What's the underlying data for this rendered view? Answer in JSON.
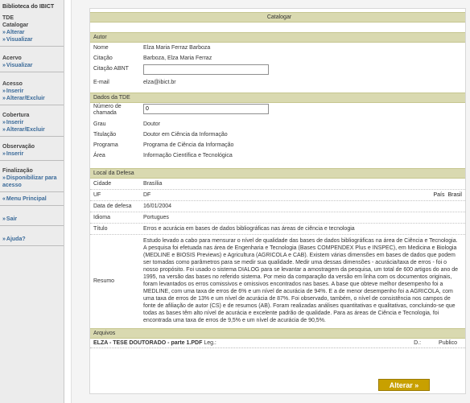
{
  "sidebar": {
    "title": "Biblioteca do IBICT",
    "tde_label": "TDE",
    "groups": [
      {
        "head": "Catalogar",
        "links": [
          "Alterar",
          "Visualizar"
        ]
      },
      {
        "head": "Acervo",
        "links": [
          "Visualizar"
        ]
      },
      {
        "head": "Acesso",
        "links": [
          "Inserir",
          "Alterar/Excluir"
        ]
      },
      {
        "head": "Cobertura",
        "links": [
          "Inserir",
          "Alterar/Excluir"
        ]
      },
      {
        "head": "Observação",
        "links": [
          "Inserir"
        ]
      },
      {
        "head": "Finalização",
        "links": [
          "Disponibilizar para acesso"
        ]
      }
    ],
    "menu_principal": "Menu Principal",
    "sair": "Sair",
    "ajuda": "Ajuda?"
  },
  "page": {
    "title": "Catalogar",
    "autor_section": "Autor",
    "nome_label": "Nome",
    "nome_value": "Elza Maria Ferraz Barboza",
    "citacao_label": "Citação",
    "citacao_value": "Barboza, Elza Maria Ferraz",
    "citacao_abnt_label": "Citação ABNT",
    "citacao_abnt_value": "",
    "email_label": "E-mail",
    "email_value": "elza@ibict.br",
    "tde_section": "Dados da TDE",
    "num_chamada_label": "Número de chamada",
    "num_chamada_value": "0",
    "grau_label": "Grau",
    "grau_value": "Doutor",
    "titulacao_label": "Titulação",
    "titulacao_value": "Doutor em Ciência da Informação",
    "programa_label": "Programa",
    "programa_value": "Programa de Ciência da Informação",
    "area_label": "Área",
    "area_value": "Informação Científica e Tecnológica",
    "local_section": "Local da Defesa",
    "cidade_label": "Cidade",
    "cidade_value": "Brasília",
    "uf_label": "UF",
    "uf_value": "DF",
    "pais_label": "País",
    "pais_value": "Brasil",
    "data_label": "Data de defesa",
    "data_value": "16/01/2004",
    "idioma_label": "Idioma",
    "idioma_value": "Portugues",
    "titulo_label": "Título",
    "titulo_value": "Erros e acurácia em bases de dados bibliográficas nas áreas de ciência e tecnologia",
    "resumo_label": "Resumo",
    "resumo_value": "Estudo levado a cabo para mensurar o nível de qualidade das bases de dados bibliográficas na área de Ciência e Tecnologia. A pesquisa foi efetuada nas área de Engenharia e Tecnologia (Bases COMPENDEX Plus e INSPEC), em Medicina e Biologia (MEDLINE e BIOSIS Previews) e Agricultura (AGRICOLA e CAB). Existem várias dimensões em bases de dados que podem ser tomadas como parâmetros para se medir sua qualidade. Medir uma dessas dimensões - acurácia/taxa de erros - foi o nosso propósito. Foi usado o sistema DIALOG para se levantar a amostragem da pesquisa, um total de 600 artigos do ano de 1995, na versão das bases no referido sistema. Por meio da comparação da versão em linha com os documentos originais, foram levantados os erros comissivos e omissivos encontrados nas bases. A base que obteve melhor desempenho foi a MEDLINE, com uma taxa de erros de 6% e um nível de acurácia de 94%. E a de menor desempenho foi a AGRICOLA, com uma taxa de erros de 13% e um nível de acurácia de 87%. Foi observado, também, o nível de consistência nos campos de fonte de afiliação de autor (CS) e de resumos (AB). Foram realizadas análises quantitativas e qualitativas, concluindo-se que todas as bases têm alto nível de acurácia e excelente padrão de qualidade. Para as áreas de Ciência e Tecnologia, foi encontrada uma taxa de erros de 9,5% e um nível de acurácia de 90,5%.",
    "arquivos_section": "Arquivos",
    "file_name": "ELZA - TESE DOUTORADO - parte 1.PDF",
    "file_leg": "Leg.:",
    "file_d": "D.:",
    "file_access": "Publico",
    "alterar_button": "Alterar »"
  }
}
